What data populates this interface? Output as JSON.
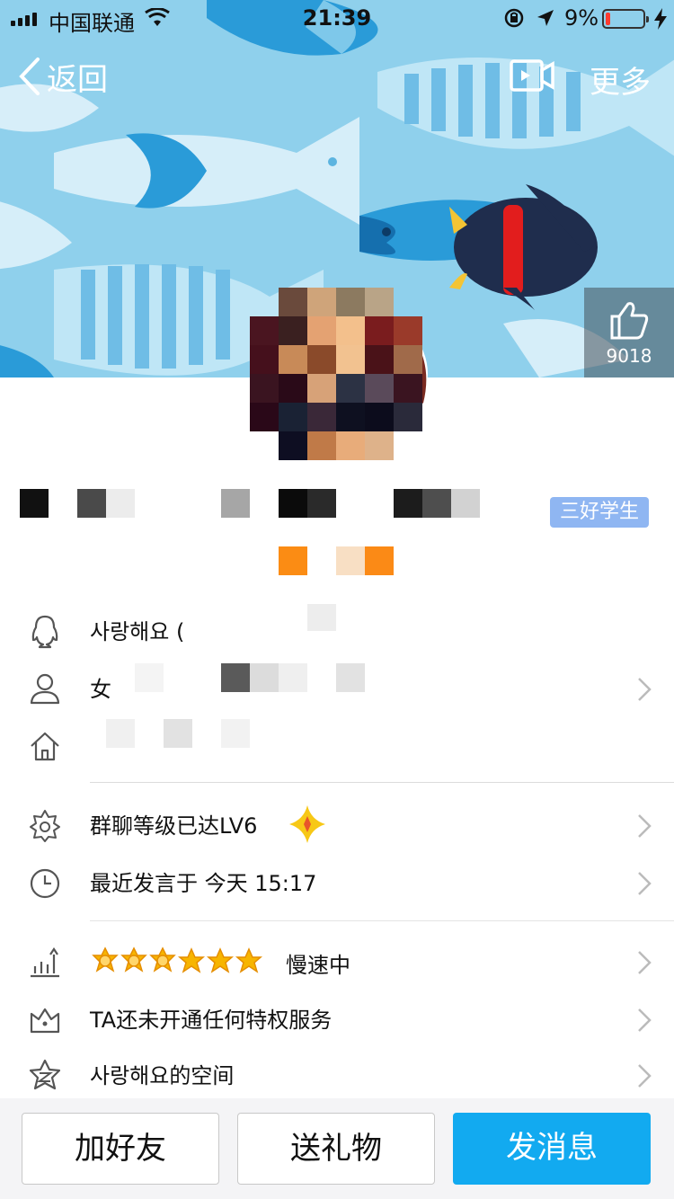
{
  "status_bar": {
    "carrier": "中国联通",
    "time": "21:39",
    "battery_percent": "9%"
  },
  "nav": {
    "back_label": "返回",
    "more_label": "更多",
    "icons": [
      "back-chevron-icon",
      "video-call-icon"
    ]
  },
  "cover": {
    "like_count": "9018",
    "like_icon": "thumbs-up-icon"
  },
  "profile": {
    "badge": "三好学生"
  },
  "rows": {
    "nickname": "사랑해요 (",
    "gender_prefix": "女",
    "group_level": "群聊等级已达LV6",
    "last_speak": "最近发言于 今天 15:17",
    "level_status": "慢速中",
    "privilege": "TA还未开通任何特权服务",
    "space": "사랑해요的空间"
  },
  "buttons": {
    "add_friend": "加好友",
    "send_gift": "送礼物",
    "send_message": "发消息"
  },
  "colors": {
    "cover_bg": "#8fd0ec",
    "primary_button": "#12aaf0",
    "badge_bg": "#8fb6f2",
    "level_star": "#f7b500"
  }
}
